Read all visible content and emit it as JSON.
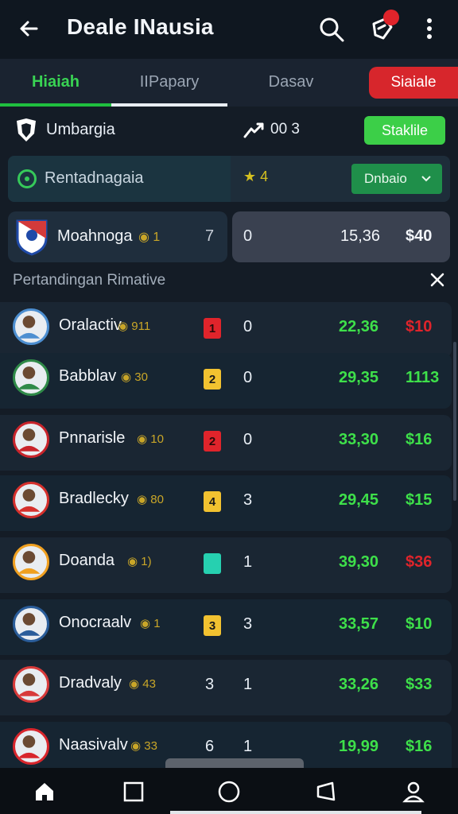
{
  "header": {
    "title": "Deale INausia"
  },
  "tabs": [
    {
      "label": "Hiaiah"
    },
    {
      "label": "IIPapary"
    },
    {
      "label": "Dasav"
    },
    {
      "label": "Siaiale"
    }
  ],
  "sub": {
    "label": "Umbargia",
    "trend_value": "00 3",
    "stat_button": "Staklile"
  },
  "filter": {
    "label": "Rentadnagaia",
    "star_value": "4",
    "dropdown": "Dnbaio"
  },
  "featured": {
    "name": "Moahnoga",
    "mini": "1",
    "num": "7",
    "goals": "0",
    "odds": "15,36",
    "price": "$40"
  },
  "section": {
    "title": "Pertandingan Rimative"
  },
  "players": [
    {
      "name": "Oralactiv",
      "mini": "911",
      "card": "1",
      "card_color": "#e0242b",
      "goals": "0",
      "odds": "22,36",
      "price": "$10",
      "price_color": "#e0242b",
      "avatar_color": "#4d8fd1"
    },
    {
      "name": "Babblav",
      "mini": "30",
      "card": "2",
      "card_color": "#f2c230",
      "goals": "0",
      "odds": "29,35",
      "price": "1113",
      "price_color": "#3ee04a",
      "avatar_color": "#2f8a48"
    },
    {
      "name": "Pnnarisle",
      "mini": "10",
      "card": "2",
      "card_color": "#e0242b",
      "goals": "0",
      "odds": "33,30",
      "price": "$16",
      "price_color": "#3ee04a",
      "avatar_color": "#c8242b"
    },
    {
      "name": "Bradlecky",
      "mini": "80",
      "card": "4",
      "card_color": "#f2c230",
      "goals": "3",
      "odds": "29,45",
      "price": "$15",
      "price_color": "#3ee04a",
      "avatar_color": "#d5302c"
    },
    {
      "name": "Doanda",
      "mini": "1)",
      "card": "",
      "card_color": "#26d0b0",
      "goals": "1",
      "odds": "39,30",
      "price": "$36",
      "price_color": "#e0242b",
      "avatar_color": "#f0a020"
    },
    {
      "name": "Onocraalv",
      "mini": "1",
      "card": "3",
      "card_color": "#f2c230",
      "goals": "3",
      "odds": "33,57",
      "price": "$10",
      "price_color": "#3ee04a",
      "avatar_color": "#2a5d9a"
    },
    {
      "name": "Dradvaly",
      "mini": "43",
      "card": "3",
      "card_color": "",
      "goals": "1",
      "odds": "33,26",
      "price": "$33",
      "price_color": "#3ee04a",
      "avatar_color": "#d83a3a"
    },
    {
      "name": "Naasivalv",
      "mini": "33",
      "card": "6",
      "card_color": "",
      "goals": "1",
      "odds": "19,99",
      "price": "$16",
      "price_color": "#3ee04a",
      "avatar_color": "#d8262c"
    }
  ],
  "colors": {
    "accent_green": "#3ee04a",
    "accent_red": "#e0242b",
    "background": "#141c26"
  }
}
